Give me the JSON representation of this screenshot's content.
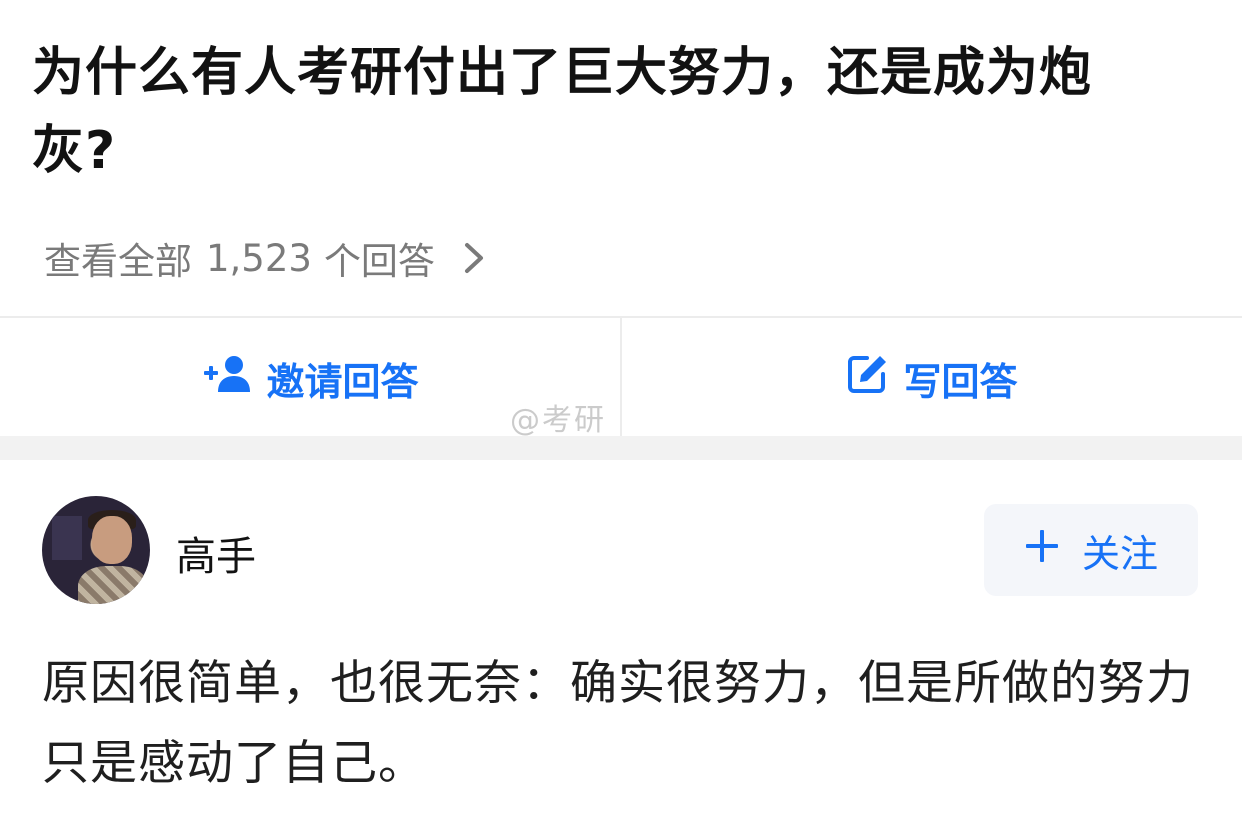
{
  "question": {
    "title": "为什么有人考研付出了巨大努力，还是成为炮灰?"
  },
  "view_all": {
    "prefix": "查看全部",
    "count": "1,523",
    "suffix": "个回答",
    "icon": "chevron-right-icon"
  },
  "actions": {
    "invite_label": "邀请回答",
    "invite_icon": "add-user-icon",
    "write_label": "写回答",
    "write_icon": "edit-icon",
    "accent_color": "#1772f6"
  },
  "watermark": {
    "text": "@考研"
  },
  "answer": {
    "author_name": "高手",
    "follow_label": "关注",
    "follow_icon": "plus-icon",
    "content": "原因很简单，也很无奈：确实很努力，但是所做的努力只是感动了自己。"
  }
}
